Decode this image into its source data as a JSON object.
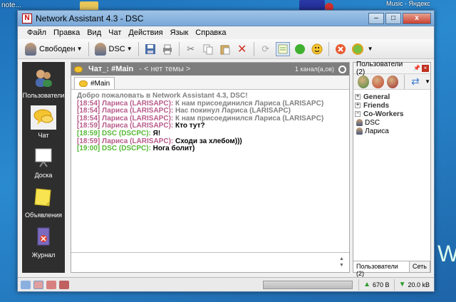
{
  "desktop": {
    "left_label": "note...",
    "right_label": "Music - Яндекс"
  },
  "window": {
    "title": "Network Assistant 4.3 - DSC",
    "minimize": "–",
    "maximize": "□",
    "close": "x"
  },
  "menu": [
    "Файл",
    "Правка",
    "Вид",
    "Чат",
    "Действия",
    "Язык",
    "Справка"
  ],
  "toolbar": {
    "status_label": "Свободен",
    "user_label": "DSC"
  },
  "nav": [
    {
      "label": "Пользователи"
    },
    {
      "label": "Чат"
    },
    {
      "label": "Доска"
    },
    {
      "label": "Объявления"
    },
    {
      "label": "Журнал"
    }
  ],
  "chat": {
    "title": "Чат_: #Main",
    "topic": "- < нет темы >",
    "channel_count": "1 канал(а,ов)",
    "tab_label": "#Main",
    "messages": [
      {
        "type": "system",
        "text": "Добро пожаловать в Network Assistant 4.3, DSC!"
      },
      {
        "type": "larisa",
        "ts": "[18:54] Лариса (LARISAPC):",
        "text": " К нам присоединился Лариса (LARISAPC)"
      },
      {
        "type": "larisa",
        "ts": "[18:54] Лариса (LARISAPC):",
        "text": " Нас покинул Лариса (LARISAPC)"
      },
      {
        "type": "larisa",
        "ts": "[18:54] Лариса (LARISAPC):",
        "text": " К нам присоединился Лариса (LARISAPC)"
      },
      {
        "type": "larisa-msg",
        "ts": "[18:59] Лариса (LARISAPC):",
        "text": " Кто тут?"
      },
      {
        "type": "dsc",
        "ts": "[18:59] DSC (DSCPC):",
        "text": " Я!"
      },
      {
        "type": "larisa-msg",
        "ts": "[18:59] Лариса (LARISAPC):",
        "text": " Сходи за хлебом)))"
      },
      {
        "type": "dsc",
        "ts": "[19:00] DSC (DSCPC):",
        "text": " Нога болит)"
      }
    ]
  },
  "users_panel": {
    "title": "Пользователи (2)",
    "groups": [
      {
        "label": "General",
        "sign": "+"
      },
      {
        "label": "Friends",
        "sign": "+"
      },
      {
        "label": "Co-Workers",
        "sign": "−"
      }
    ],
    "users": [
      "DSC",
      "Лариса"
    ],
    "tabs": [
      "Пользователи (2)",
      "Сеть"
    ]
  },
  "statusbar": {
    "upload": "670 B",
    "download": "20.0 kB"
  }
}
